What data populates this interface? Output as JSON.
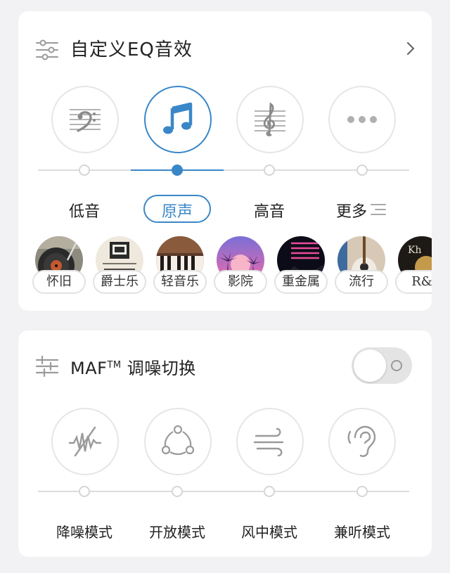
{
  "colors": {
    "accent": "#3a87c8",
    "icon_gray": "#9a9a9a",
    "track": "#dcdcdc",
    "background": "#f2f1f3"
  },
  "eq_section": {
    "title": "自定义EQ音效",
    "icons": {
      "settings": "sliders-icon",
      "arrow": "chevron-right-icon"
    },
    "modes": [
      {
        "label": "低音",
        "icon": "bass-clef-icon",
        "selected": false
      },
      {
        "label": "原声",
        "icon": "music-note-icon",
        "selected": true
      },
      {
        "label": "高音",
        "icon": "treble-clef-icon",
        "selected": false
      },
      {
        "label": "更多",
        "icon": "more-dots-icon",
        "selected": false
      }
    ],
    "presets": [
      {
        "label": "怀旧",
        "icon": "vinyl-record-image"
      },
      {
        "label": "爵士乐",
        "icon": "jazz-album-image"
      },
      {
        "label": "轻音乐",
        "icon": "piano-image"
      },
      {
        "label": "影院",
        "icon": "palm-sunset-image"
      },
      {
        "label": "重金属",
        "icon": "neon-sunset-image"
      },
      {
        "label": "流行",
        "icon": "guitar-image"
      },
      {
        "label": "R&",
        "icon": "rnb-album-image"
      }
    ]
  },
  "maf_section": {
    "title": "MAF",
    "title_sup": "TM",
    "title_rest": " 调噪切换",
    "toggle_on": false,
    "modes": [
      {
        "label": "降噪模式",
        "icon": "noise-cancel-icon"
      },
      {
        "label": "开放模式",
        "icon": "share-nodes-icon"
      },
      {
        "label": "风中模式",
        "icon": "wind-icon"
      },
      {
        "label": "兼听模式",
        "icon": "ear-icon"
      }
    ]
  }
}
